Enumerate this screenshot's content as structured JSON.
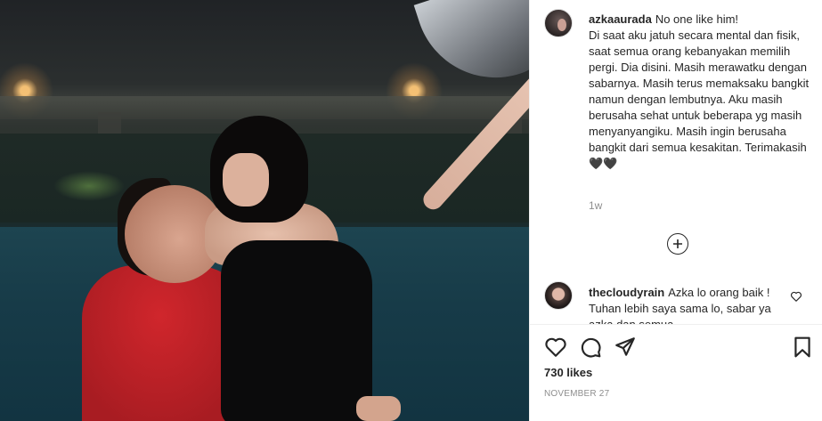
{
  "post": {
    "username": "azkaaurada",
    "caption": "No one like him!\nDi saat aku jatuh secara mental dan fisik, saat semua orang kebanyakan memilih pergi. Dia disini. Masih merawatku dengan sabarnya. Masih terus memaksaku bangkit namun dengan lembutnya. Aku masih berusaha sehat untuk beberapa yg masih menyanyangiku. Masih ingin berusaha bangkit dari semua kesakitan. Terimakasih🖤🖤",
    "time_ago": "1w",
    "likes": "730 likes",
    "date": "NOVEMBER 27"
  },
  "comments": [
    {
      "username": "thecloudyrain",
      "text": "Azka lo orang baik ! Tuhan lebih saya sama lo, sabar ya azka dan semua"
    }
  ],
  "icons": {
    "load_more": "plus-circle-icon",
    "like": "heart-icon",
    "comment": "comment-icon",
    "share": "share-icon",
    "save": "bookmark-icon"
  }
}
